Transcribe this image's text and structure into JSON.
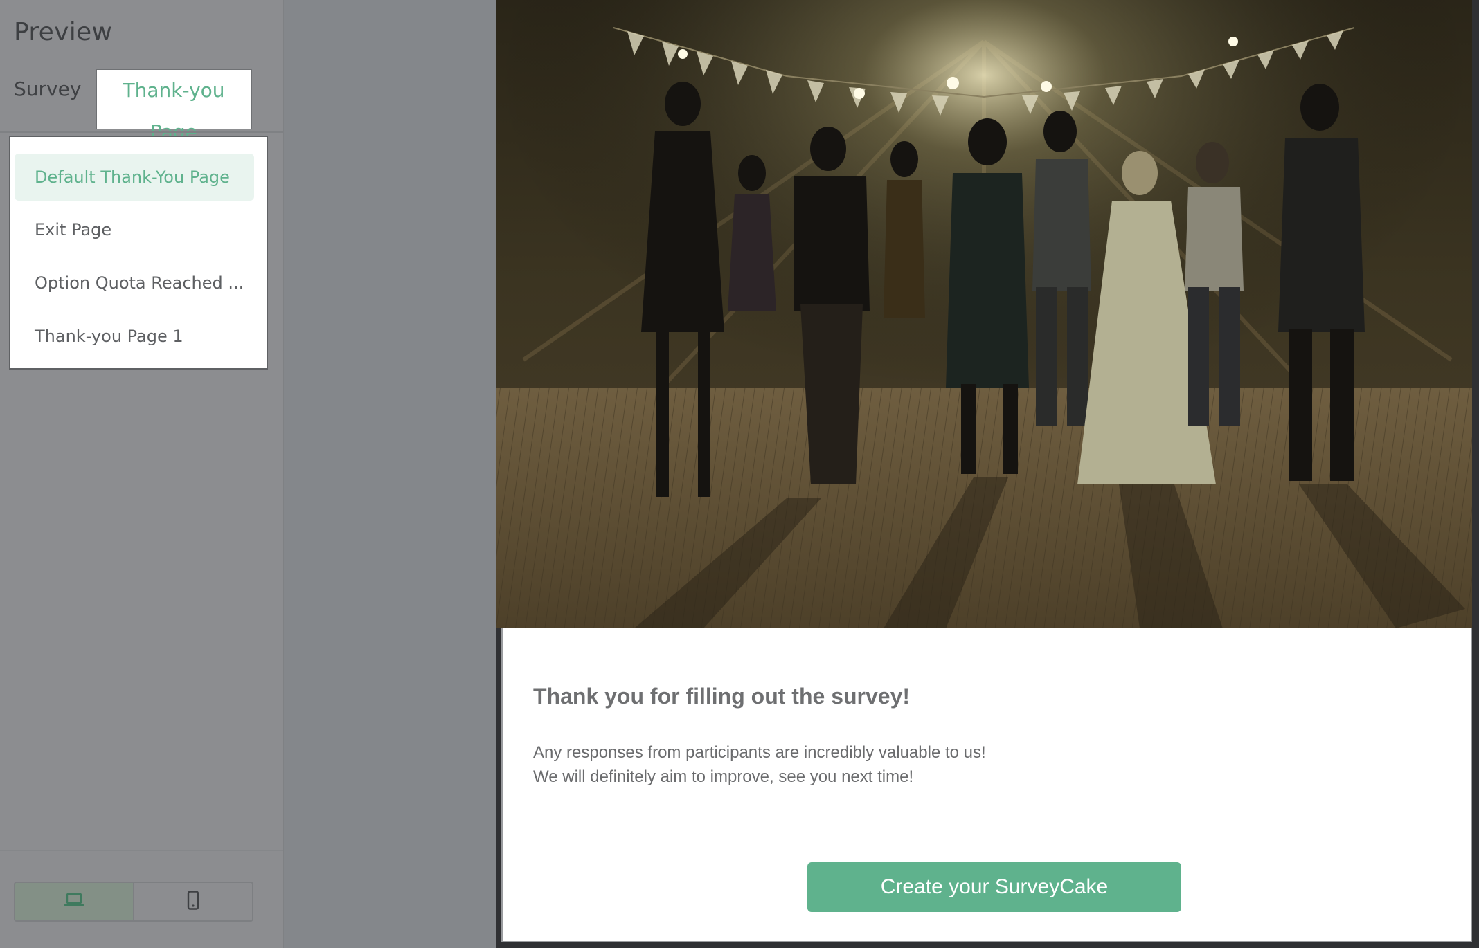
{
  "sidebar": {
    "title": "Preview",
    "tabs": [
      {
        "label": "Survey",
        "active": false
      },
      {
        "label": "Thank-you Page",
        "active": true
      }
    ],
    "dropdown_items": [
      {
        "label": "Default Thank-You Page",
        "selected": true
      },
      {
        "label": "Exit Page",
        "selected": false
      },
      {
        "label": "Option Quota Reached ...",
        "selected": false
      },
      {
        "label": "Thank-you Page 1",
        "selected": false
      }
    ],
    "device_toggle": [
      {
        "icon": "laptop-icon",
        "active": true
      },
      {
        "icon": "mobile-phone-icon",
        "active": false
      }
    ]
  },
  "preview": {
    "hero_image": "wedding-party-dancing-photo",
    "title": "Thank you for filling out the survey!",
    "body_lines": [
      "Any responses from participants are incredibly valuable to us!",
      "We will definitely aim to improve, see you next time!"
    ],
    "cta_label": "Create your SurveyCake"
  },
  "colors": {
    "accent": "#5fb28d",
    "accent_light": "#e9f4ef",
    "overlay": "#84878b"
  }
}
